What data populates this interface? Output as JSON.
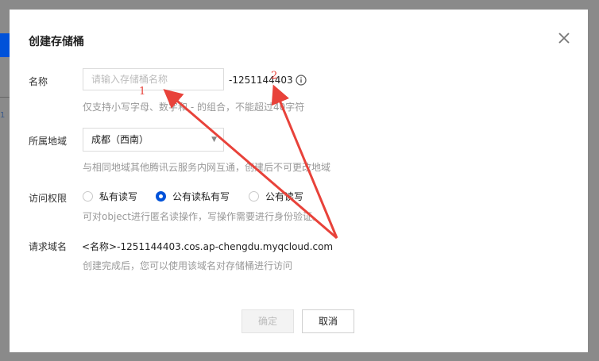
{
  "background": {
    "fragment_text": "1"
  },
  "dialog": {
    "title": "创建存储桶",
    "name": {
      "label": "名称",
      "placeholder": "请输入存储桶名称",
      "suffix": "-1251144403",
      "hint": "仅支持小写字母、数字和 - 的组合，不能超过40字符"
    },
    "region": {
      "label": "所属地域",
      "value": "成都（西南）",
      "hint": "与相同地域其他腾讯云服务内网互通，创建后不可更改地域"
    },
    "access": {
      "label": "访问权限",
      "options": [
        "私有读写",
        "公有读私有写",
        "公有读写"
      ],
      "selected": "公有读私有写",
      "hint": "可对object进行匿名读操作，写操作需要进行身份验证。"
    },
    "domain": {
      "label": "请求域名",
      "value": "<名称>-1251144403.cos.ap-chengdu.myqcloud.com",
      "hint": "创建完成后，您可以使用该域名对存储桶进行访问"
    },
    "buttons": {
      "ok": "确定",
      "cancel": "取消"
    }
  },
  "annotations": {
    "marker_1": "1",
    "marker_2": "2",
    "color": "#e8423a"
  },
  "colors": {
    "primary": "#0052d9"
  }
}
